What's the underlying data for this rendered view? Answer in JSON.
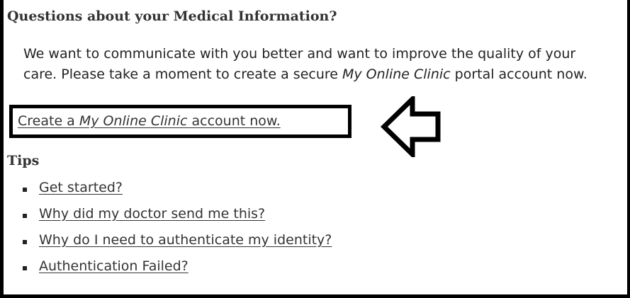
{
  "header": {
    "title": "Questions about your Medical Information?"
  },
  "intro": {
    "part1": "We want to communicate with you better and want to improve the quality of your care. Please take a moment to create a secure ",
    "emphasis": "My Online Clinic",
    "part2": " portal account now."
  },
  "cta": {
    "prefix": "Create a ",
    "emphasis": "My Online Clinic",
    "suffix": " account now."
  },
  "annotation": {
    "icon": "left-arrow-icon"
  },
  "tips": {
    "title": "Tips",
    "items": [
      {
        "label": "Get started?"
      },
      {
        "label": "Why did my doctor send me this?"
      },
      {
        "label": "Why do I need to authenticate my identity?"
      },
      {
        "label": "Authentication Failed?"
      }
    ]
  }
}
